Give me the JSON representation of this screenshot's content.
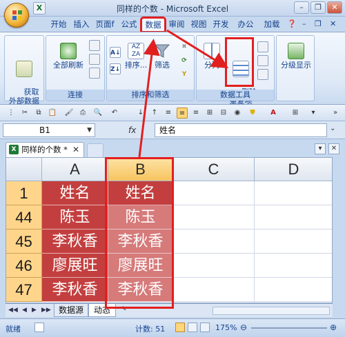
{
  "app": {
    "title": "同样的个数 - Microsoft Excel"
  },
  "ribbon_tabs": [
    "开始",
    "插入",
    "页面f",
    "公式",
    "数据",
    "审阅",
    "视图",
    "开发",
    "办公",
    "加载"
  ],
  "ribbon_tab_active": "数据",
  "ribbon": {
    "get_external_label": "获取\n外部数据",
    "refresh_all_label": "全部刷新",
    "connections_group": "连接",
    "sort_label": "排序...",
    "filter_label": "筛选",
    "sort_filter_group": "排序和筛选",
    "split_label": "分列",
    "remove_duplicates_label": "删除\n重复项",
    "data_tools_group": "数据工具",
    "outline_label": "分级显示"
  },
  "formula_bar": {
    "name_box": "B1",
    "fx": "fx",
    "formula": "姓名"
  },
  "workbook_tab": {
    "title": "同样的个数 *"
  },
  "columns": [
    "A",
    "B",
    "C",
    "D"
  ],
  "rows": [
    {
      "num": "1",
      "a": "姓名",
      "b": "姓名"
    },
    {
      "num": "44",
      "a": "陈玉",
      "b": "陈玉"
    },
    {
      "num": "45",
      "a": "李秋香",
      "b": "李秋香"
    },
    {
      "num": "46",
      "a": "廖展旺",
      "b": "廖展旺"
    },
    {
      "num": "47",
      "a": "李秋香",
      "b": "李秋香"
    }
  ],
  "sheet_tabs": [
    "数据源",
    "动态"
  ],
  "status": {
    "ready": "就绪",
    "count": "计数: 51",
    "zoom": "175%"
  },
  "colors": {
    "annotation": "#e21f1f",
    "duplicate_fill": "#c33f3f",
    "selected_fill": "#d67a7a",
    "row_header": "#ffd58c"
  }
}
